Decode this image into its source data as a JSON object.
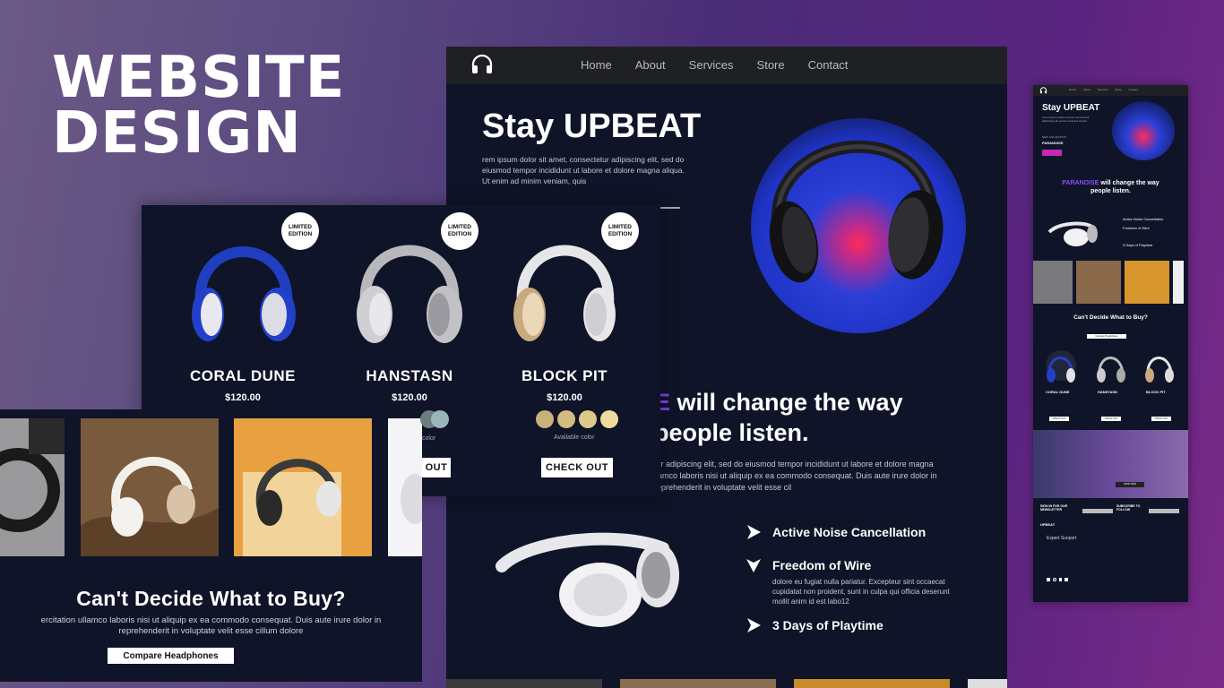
{
  "headline": {
    "line1": "WEBSITE",
    "line2": "DESIGN"
  },
  "main_site": {
    "nav": [
      "Home",
      "About",
      "Services",
      "Store",
      "Contact"
    ],
    "hero_title": "Stay UPBEAT",
    "hero_text": "rem ipsum dolor sit amet, consectetur adipiscing elit, sed do eiusmod tempor incididunt ut labore et dolore magna aliqua. Ut enim ad minim veniam, quis",
    "change_accent": "E",
    "change_line1": " will change the way",
    "change_line2": "people listen.",
    "change_text": "tur adipiscing elit, sed do eiusmod tempor incididunt ut labore et dolore magna llamco laboris nisi ut aliquip ex ea commodo consequat. Duis aute irure dolor in reprehenderit in voluptate velit esse cil",
    "features": [
      {
        "label": "Active Noise Cancellation"
      },
      {
        "label": "Freedom of Wire"
      },
      {
        "label": "3 Days of Playtime"
      }
    ],
    "feature_text": "dolore eu fugiat nulla pariatur. Excepteur sint occaecat cupidatat non proident, sunt in culpa qui officia deserunt mollit anim id est labo12"
  },
  "products": {
    "badge": "LIMITED EDITION",
    "items": [
      {
        "name": "CORAL DUNE",
        "price": "$120.00"
      },
      {
        "name": "HANSTASN",
        "price": "$120.00"
      },
      {
        "name": "BLOCK PIT",
        "price": "$120.00"
      }
    ],
    "available_label": "Available color",
    "partial_available": "color",
    "checkout_label": "CHECK OUT",
    "partial_checkout": "OUT",
    "swatch_colors_3": [
      "#c9b27a",
      "#d2bc80",
      "#dcc888",
      "#e6d496"
    ],
    "swatch_colors_2": [
      "#6c7d80",
      "#9bb6b8"
    ]
  },
  "compare": {
    "title": "Can't Decide What to Buy?",
    "text": "ercitation ullamco laboris nisi ut aliquip ex ea commodo consequat. Duis aute irure dolor in reprehenderit in voluptate velit esse cillum dolore",
    "button": "Compare Headphones"
  },
  "mobile": {
    "nav": [
      "Home",
      "About",
      "Services",
      "Store",
      "Contact"
    ],
    "hero_title": "Stay UPBEAT",
    "new_collection": "NEW COLLECTION",
    "collection_name": "PARANOISE",
    "accent": "PARANOISE",
    "change_rest": " will change the way",
    "change_line2": "people listen.",
    "features": [
      "Active Noise Cancellation",
      "Freedom of Wire",
      "3 Days of Playtime"
    ],
    "compare_title": "Can't Decide What to Buy?",
    "compare_button": "Compare Headphones",
    "products": [
      {
        "name": "CORAL DUNE",
        "price": "$120.00"
      },
      {
        "name": "HANSTASN",
        "price": "$120.00"
      },
      {
        "name": "BLOCK PIT",
        "price": "$120.00"
      }
    ],
    "checkout": "CHECK OUT",
    "signin": "SIGN IN FOR OUR NEWSLETTER",
    "subscribe": "SUBSCRIBE TO FOLLOW",
    "brand": "UPBEAT",
    "support": "Expert Suoport",
    "shop_now": "SHOP NOW"
  }
}
